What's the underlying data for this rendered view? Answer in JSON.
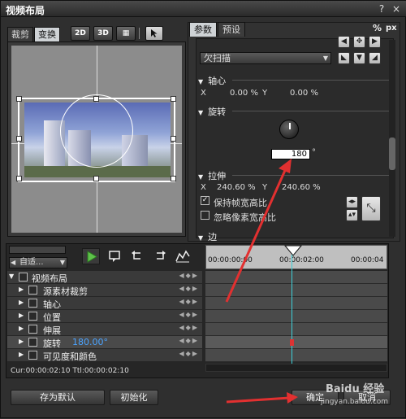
{
  "window": {
    "title": "视频布局",
    "help": "?",
    "close": "×"
  },
  "left_tabs": [
    "裁剪",
    "变换"
  ],
  "mode_buttons": [
    "2D",
    "3D",
    "▦"
  ],
  "right_tabs": [
    "参数",
    "预设"
  ],
  "corner_icons": [
    "%",
    "px"
  ],
  "scan_mode": "欠扫描",
  "axis": {
    "title": "轴心",
    "x_label": "X",
    "x_value": "0.00 %",
    "y_label": "Y",
    "y_value": "0.00 %"
  },
  "rotation": {
    "title": "旋转",
    "value": "180",
    "unit": "°"
  },
  "stretch": {
    "title": "拉伸",
    "x_label": "X",
    "x_value": "240.60 %",
    "y_label": "Y",
    "y_value": "240.60 %"
  },
  "checkboxes": [
    {
      "label": "保持帧宽高比",
      "checked": true
    },
    {
      "label": "忽略像素宽高比",
      "checked": false
    }
  ],
  "border_title": "边",
  "timeline": {
    "zoom_select": "自适...",
    "rows": [
      {
        "name": "视频布局",
        "level": 0
      },
      {
        "name": "源素材裁剪",
        "level": 1
      },
      {
        "name": "轴心",
        "level": 1
      },
      {
        "name": "位置",
        "level": 1
      },
      {
        "name": "伸展",
        "level": 1
      },
      {
        "name": "旋转",
        "level": 1,
        "value": "180.00°"
      },
      {
        "name": "可见度和颜色",
        "level": 1
      }
    ],
    "ruler": [
      "00:00:00:00",
      "00:00:02:00",
      "00:00:04"
    ],
    "status": "Cur:00:00:02:10 Ttl:00:00:02:10"
  },
  "footer": {
    "save_default": "存为默认",
    "initialize": "初始化",
    "ok": "确定",
    "cancel": "取消"
  },
  "watermark": "Baidu 经验",
  "watermark_sub": "jingyan.baidu.com"
}
